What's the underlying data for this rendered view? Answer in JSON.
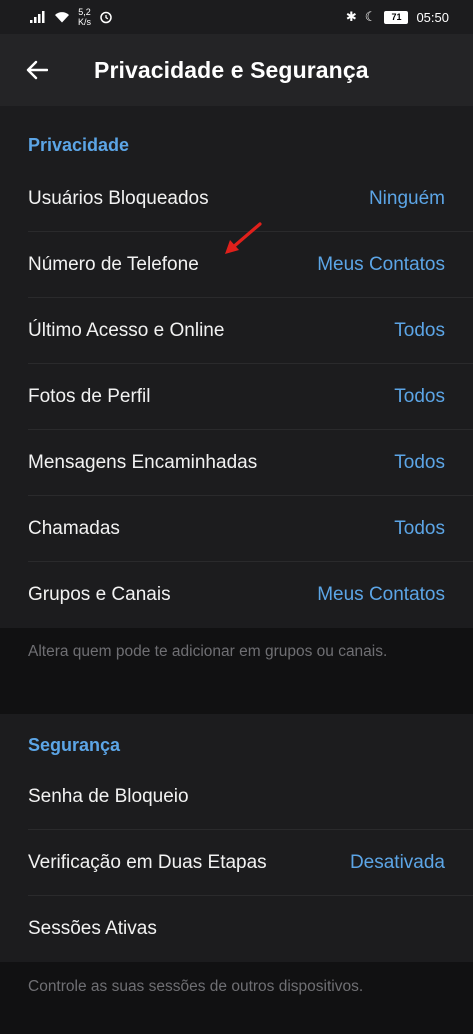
{
  "status_bar": {
    "speed_value": "5,2",
    "speed_unit": "K/s",
    "battery": "71",
    "time": "05:50"
  },
  "header": {
    "title": "Privacidade e Segurança"
  },
  "privacy": {
    "title": "Privacidade",
    "items": [
      {
        "label": "Usuários Bloqueados",
        "value": "Ninguém"
      },
      {
        "label": "Número de Telefone",
        "value": "Meus Contatos"
      },
      {
        "label": "Último Acesso e Online",
        "value": "Todos"
      },
      {
        "label": "Fotos de Perfil",
        "value": "Todos"
      },
      {
        "label": "Mensagens Encaminhadas",
        "value": "Todos"
      },
      {
        "label": "Chamadas",
        "value": "Todos"
      },
      {
        "label": "Grupos e Canais",
        "value": "Meus Contatos"
      }
    ],
    "footer": "Altera quem pode te adicionar em grupos ou canais."
  },
  "security": {
    "title": "Segurança",
    "items": [
      {
        "label": "Senha de Bloqueio",
        "value": ""
      },
      {
        "label": "Verificação em Duas Etapas",
        "value": "Desativada"
      },
      {
        "label": "Sessões Ativas",
        "value": ""
      }
    ],
    "footer": "Controle as suas sessões de outros dispositivos."
  },
  "colors": {
    "accent": "#5ca5e6",
    "background": "#1c1c1e",
    "header_bg": "#242426",
    "footer_bg": "#111112",
    "annotation_arrow": "#e0201b"
  }
}
